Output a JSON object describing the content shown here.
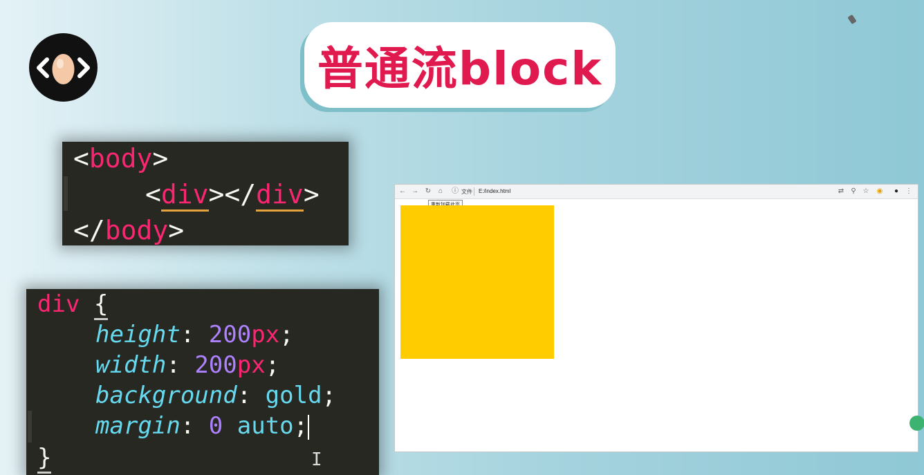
{
  "title": "普通流block",
  "html_code": {
    "l1_open": "<",
    "l1_tag": "body",
    "l1_close": ">",
    "l2_open": "<",
    "l2_tag": "div",
    "l2_mid": "></",
    "l2_tag2": "div",
    "l2_close": ">",
    "l3_open": "</",
    "l3_tag": "body",
    "l3_close": ">"
  },
  "css_code": {
    "selector": "div",
    "open_brace": "{",
    "rules": [
      {
        "prop": "height",
        "value": "200",
        "unit": "px"
      },
      {
        "prop": "width",
        "value": "200",
        "unit": "px"
      },
      {
        "prop": "background",
        "value": "gold",
        "unit": ""
      },
      {
        "prop": "margin",
        "num": "0",
        "value": "auto",
        "unit": ""
      }
    ],
    "close_brace": "}"
  },
  "browser": {
    "back": "←",
    "forward": "→",
    "reload_tooltip": "重新加载此页",
    "home": "⌂",
    "info_label": "文件",
    "address": "E:/index.html",
    "box_color": "#ffcc00"
  },
  "colors": {
    "accent": "#e0194f",
    "code_bg": "#272822"
  }
}
